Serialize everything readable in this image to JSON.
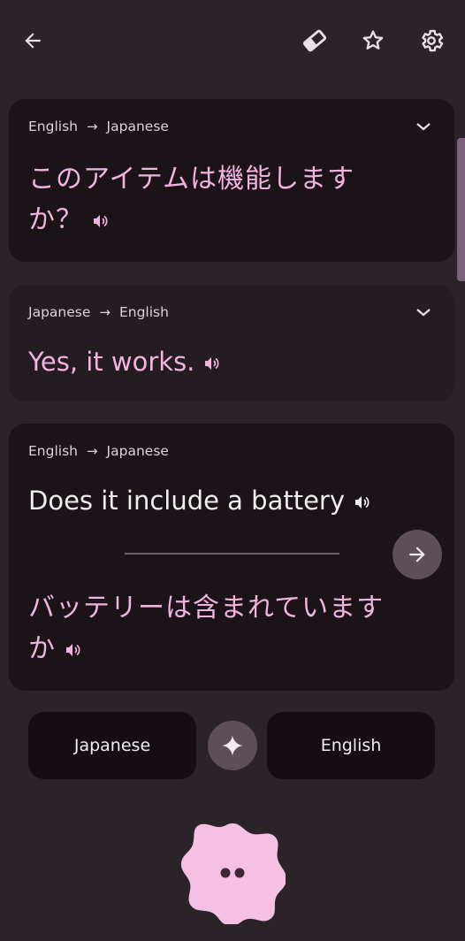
{
  "cards": [
    {
      "from": "English",
      "to": "Japanese",
      "line1": "このアイテムは機能します",
      "line2": "か？"
    },
    {
      "from": "Japanese",
      "to": "English",
      "text": "Yes, it works."
    },
    {
      "from": "English",
      "to": "Japanese",
      "source": "Does it include a battery",
      "line1": "バッテリーは含まれています",
      "line2": "か"
    }
  ],
  "lang_buttons": {
    "left": "Japanese",
    "right": "English"
  },
  "colors": {
    "background": "#2a2428",
    "accent_pink": "#f4b3df",
    "card_dark": "#1a1317"
  }
}
